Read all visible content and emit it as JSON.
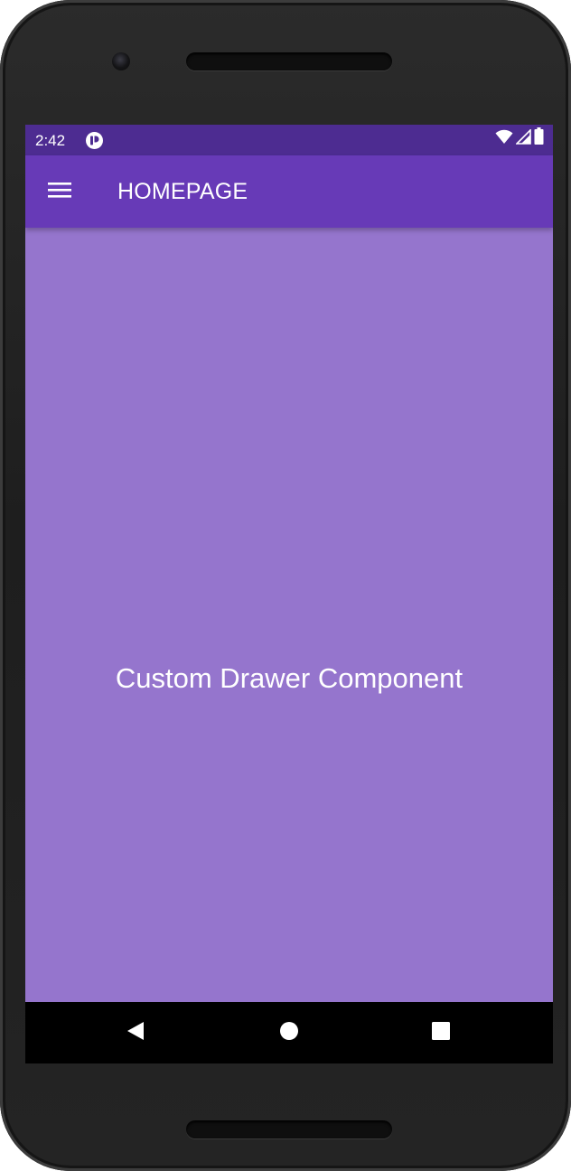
{
  "status_bar": {
    "time": "2:42",
    "icons": [
      "app-notification-icon",
      "wifi-icon",
      "cell-signal-icon",
      "battery-icon"
    ]
  },
  "app_bar": {
    "title": "HOMEPAGE",
    "menu_icon": "hamburger-menu-icon"
  },
  "content": {
    "text": "Custom Drawer Component"
  },
  "nav_bar": {
    "buttons": [
      "back-icon",
      "home-icon",
      "recents-icon"
    ]
  },
  "colors": {
    "status_bar": "#4d2c91",
    "app_bar": "#673ab7",
    "background": "#9575cd",
    "nav_bar": "#000000"
  }
}
